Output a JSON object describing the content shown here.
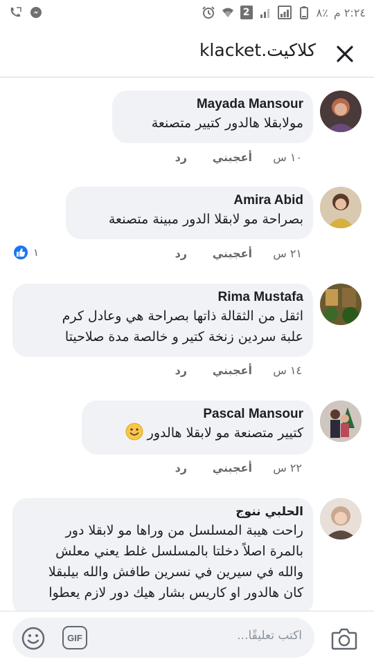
{
  "status_bar": {
    "time": "٢:٢٤ م",
    "battery": "٨٪",
    "sim_badge": "2"
  },
  "header": {
    "title": "klacket.كلاكيت"
  },
  "comments": [
    {
      "name": "Mayada Mansour",
      "lines": [
        "مولابقلا هالدور كتيير متصنعة"
      ],
      "time": "١٠ س",
      "like_label": "أعجبني",
      "reply_label": "رد",
      "avatar_color": "#a85a4a"
    },
    {
      "name": "Amira Abid",
      "lines": [
        "بصراحة مو لابقلا الدور مبينة متصنعة"
      ],
      "time": "٢١ س",
      "like_label": "أعجبني",
      "reply_label": "رد",
      "reaction_count": "١",
      "avatar_color": "#c9a36b"
    },
    {
      "name": "Rima Mustafa",
      "lines": [
        "اثقل من الثقالة ذاتها بصراحة هي وعادل كرم",
        "علبة سردين زنخة كتير و خالصة مدة صلاحيتا"
      ],
      "time": "١٤ س",
      "like_label": "أعجبني",
      "reply_label": "رد",
      "avatar_color": "#8a6a3a"
    },
    {
      "name": "Pascal Mansour",
      "lines": [
        "كتيير متصنعة مو لابقلا هالدور"
      ],
      "time": "٢٢ س",
      "like_label": "أعجبني",
      "reply_label": "رد",
      "avatar_color": "#7a6a6a"
    },
    {
      "name": "الحلبي ننوج",
      "lines": [
        "راحت هيبة المسلسل من وراها مو لابقلا دور",
        "بالمرة اصلاً دخلتا بالمسلسل غلط يعني معلش",
        "والله في سيرين في نسرين طافش والله بيلبقلا",
        "كان هالدور او كاريس بشار هيك دور لازم يعطوا"
      ],
      "avatar_color": "#b8a898"
    }
  ],
  "composer": {
    "placeholder": "اكتب تعليقًا...",
    "gif_label": "GIF"
  },
  "colors": {
    "bubble": "#f0f2f5",
    "like_blue": "#1877f2",
    "meta_gray": "#65676b"
  }
}
